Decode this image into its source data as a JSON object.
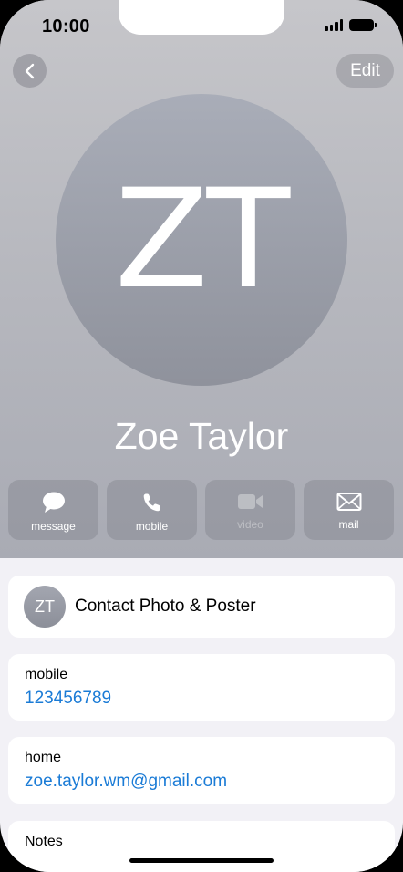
{
  "status_bar": {
    "time": "10:00"
  },
  "nav": {
    "edit_label": "Edit"
  },
  "contact": {
    "initials": "ZT",
    "name": "Zoe Taylor"
  },
  "actions": [
    {
      "label": "message",
      "icon": "message-bubble-icon",
      "enabled": true
    },
    {
      "label": "mobile",
      "icon": "phone-icon",
      "enabled": true
    },
    {
      "label": "video",
      "icon": "video-camera-icon",
      "enabled": false
    },
    {
      "label": "mail",
      "icon": "envelope-icon",
      "enabled": true
    }
  ],
  "photo_card": {
    "initials": "ZT",
    "title": "Contact Photo & Poster"
  },
  "fields": [
    {
      "label": "mobile",
      "value": "123456789"
    },
    {
      "label": "home",
      "value": "zoe.taylor.wm@gmail.com"
    }
  ],
  "notes": {
    "label": "Notes"
  },
  "colors": {
    "link": "#1a7bd6",
    "background": "#f2f1f6",
    "header_top": "#c6c6ca",
    "header_bottom": "#a9abb4"
  }
}
